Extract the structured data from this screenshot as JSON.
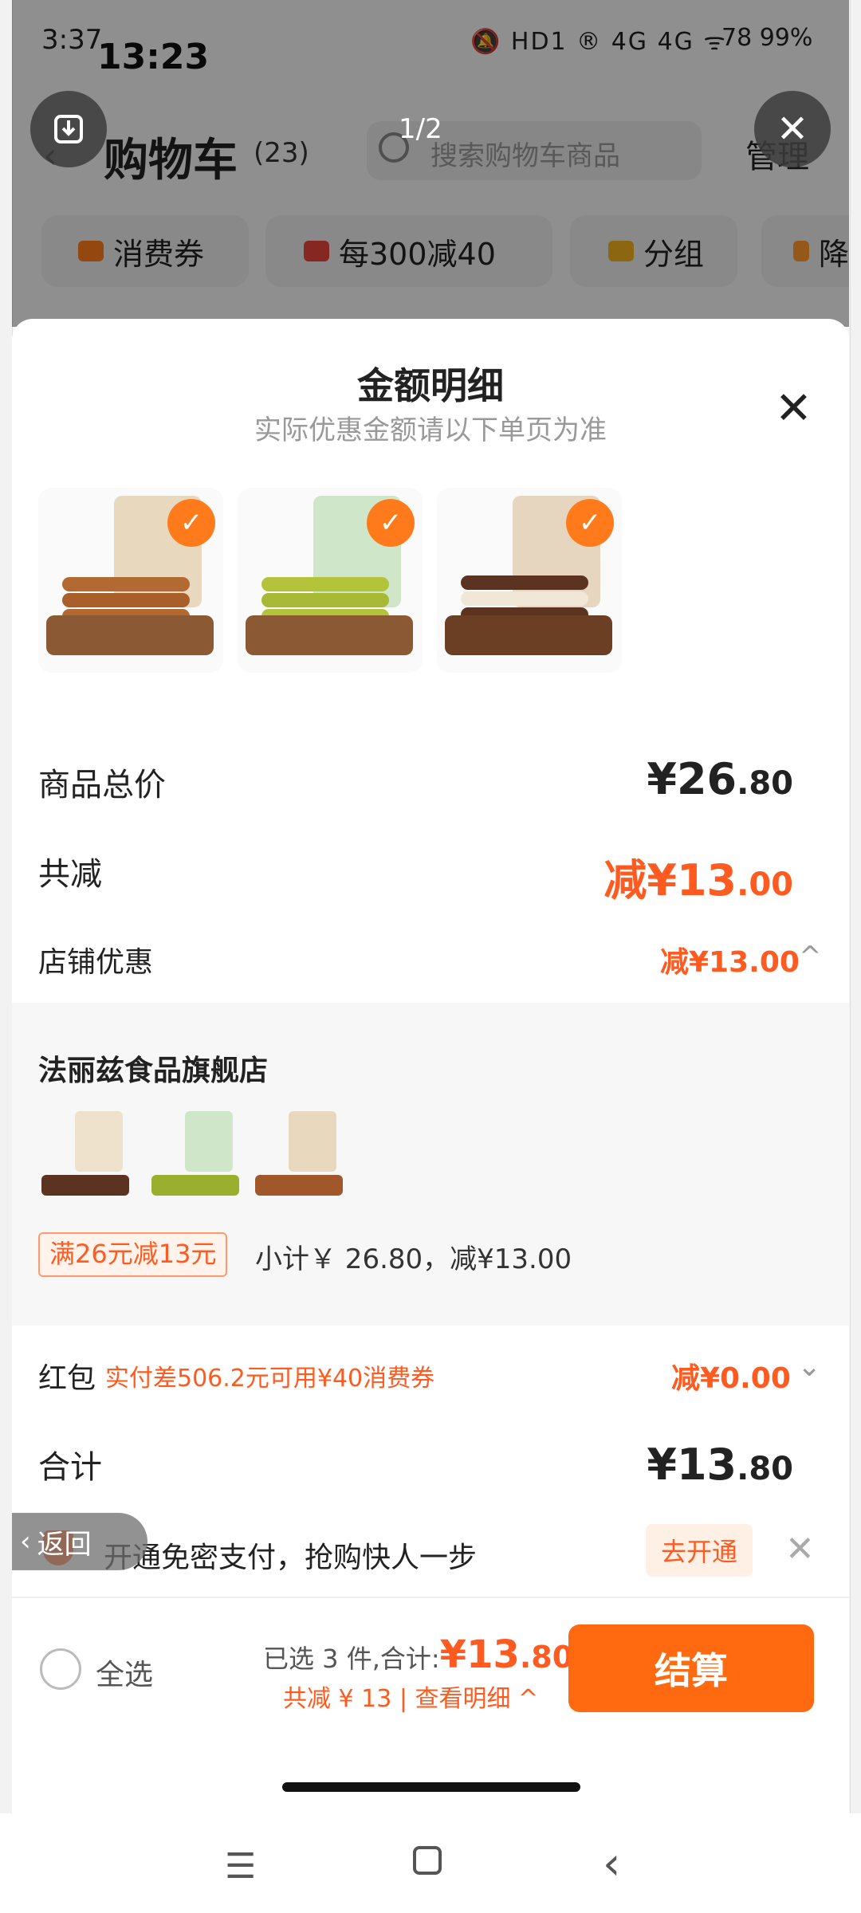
{
  "status": {
    "time_small": "3:37",
    "time_big": "13:23",
    "icons": "🔕 HD1 ® 4G 4G ᯤ",
    "battery": "78 99%"
  },
  "viewer": {
    "page_indicator": "1/2"
  },
  "cart": {
    "title": "购物车",
    "count": "(23)",
    "search_placeholder": "搜索购物车商品",
    "manage": "管理",
    "chips": [
      "消费券",
      "每300减40",
      "分组",
      "降"
    ]
  },
  "sheet": {
    "title": "金额明细",
    "subtitle": "实际优惠金额请以下单页为准",
    "rows": {
      "goods_total": {
        "label": "商品总价",
        "currency": "¥",
        "int": "26",
        "dec": ".80"
      },
      "total_reduce": {
        "label": "共减",
        "prefix": "减",
        "currency": "¥",
        "int": "13",
        "dec": ".00"
      },
      "store_discount": {
        "label": "店铺优惠",
        "value": "减¥13.00",
        "chevron": "^"
      }
    },
    "store": {
      "name": "法丽兹食品旗舰店",
      "promo": "满26元减13元",
      "subtotal": "小计￥ 26.80，减¥13.00"
    },
    "redbag": {
      "label": "红包",
      "note": "实付差506.2元可用¥40消费券",
      "value": "减¥0.00",
      "chevron": "⌄"
    },
    "sum": {
      "label": "合计",
      "currency": "¥",
      "int": "13",
      "dec": ".80"
    }
  },
  "openpay": {
    "return_label": "返回",
    "text": "开通免密支付，抢购快人一步",
    "button": "去开通",
    "close": "✕"
  },
  "bottom": {
    "select_all": "全选",
    "selected_prefix": "已选 3 件,合计:",
    "total_currency": "¥",
    "total_int": "13",
    "total_dec": ".80",
    "discount": "共减 ¥ 13 | 查看明细 ^",
    "checkout": "结算"
  },
  "colors": {
    "accent": "#ff5a1f",
    "button": "#ff6a10",
    "check": "#ff7a1a"
  },
  "icons": [
    "download-icon",
    "close-icon",
    "search-icon",
    "check-icon",
    "chevron-up-icon",
    "chevron-down-icon",
    "shield-icon",
    "menu-icon",
    "home-icon",
    "back-icon"
  ]
}
